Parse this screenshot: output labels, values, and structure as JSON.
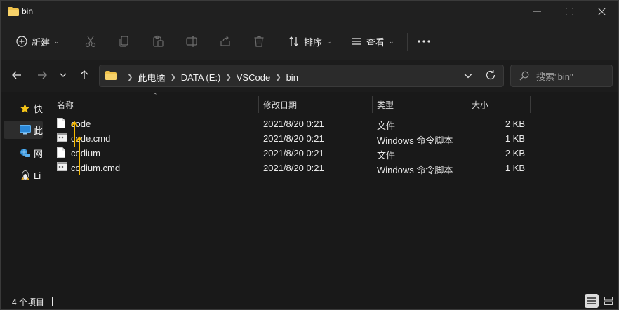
{
  "window": {
    "title": "bin"
  },
  "titlebar": {
    "minimize_icon": "minimize-icon",
    "maximize_icon": "maximize-icon",
    "close_icon": "close-icon"
  },
  "toolbar": {
    "new_label": "新建",
    "sort_label": "排序",
    "view_label": "查看",
    "icons": [
      "cut-icon",
      "copy-icon",
      "paste-icon",
      "rename-icon",
      "share-icon",
      "delete-icon",
      "more-icon"
    ]
  },
  "address": {
    "crumbs": [
      "此电脑",
      "DATA (E:)",
      "VSCode",
      "bin"
    ]
  },
  "search": {
    "placeholder": "搜索\"bin\""
  },
  "navpane": {
    "items": [
      {
        "label": "快",
        "icon": "star-icon"
      },
      {
        "label": "此",
        "icon": "pc-icon"
      },
      {
        "label": "网",
        "icon": "network-icon"
      },
      {
        "label": "Li",
        "icon": "linux-icon"
      }
    ]
  },
  "columns": {
    "name": "名称",
    "date": "修改日期",
    "type": "类型",
    "size": "大小"
  },
  "files": [
    {
      "name": "code",
      "date": "2021/8/20 0:21",
      "type": "文件",
      "size": "2 KB",
      "icon": "file-icon"
    },
    {
      "name": "code.cmd",
      "date": "2021/8/20 0:21",
      "type": "Windows 命令脚本",
      "size": "1 KB",
      "icon": "cmd-file-icon"
    },
    {
      "name": "codium",
      "date": "2021/8/20 0:21",
      "type": "文件",
      "size": "2 KB",
      "icon": "file-icon"
    },
    {
      "name": "codium.cmd",
      "date": "2021/8/20 0:21",
      "type": "Windows 命令脚本",
      "size": "1 KB",
      "icon": "cmd-file-icon"
    }
  ],
  "status": {
    "count": "4 个项目"
  },
  "colors": {
    "accent": "#f5b800",
    "folder": "#f0c24b",
    "background": "#191919"
  }
}
